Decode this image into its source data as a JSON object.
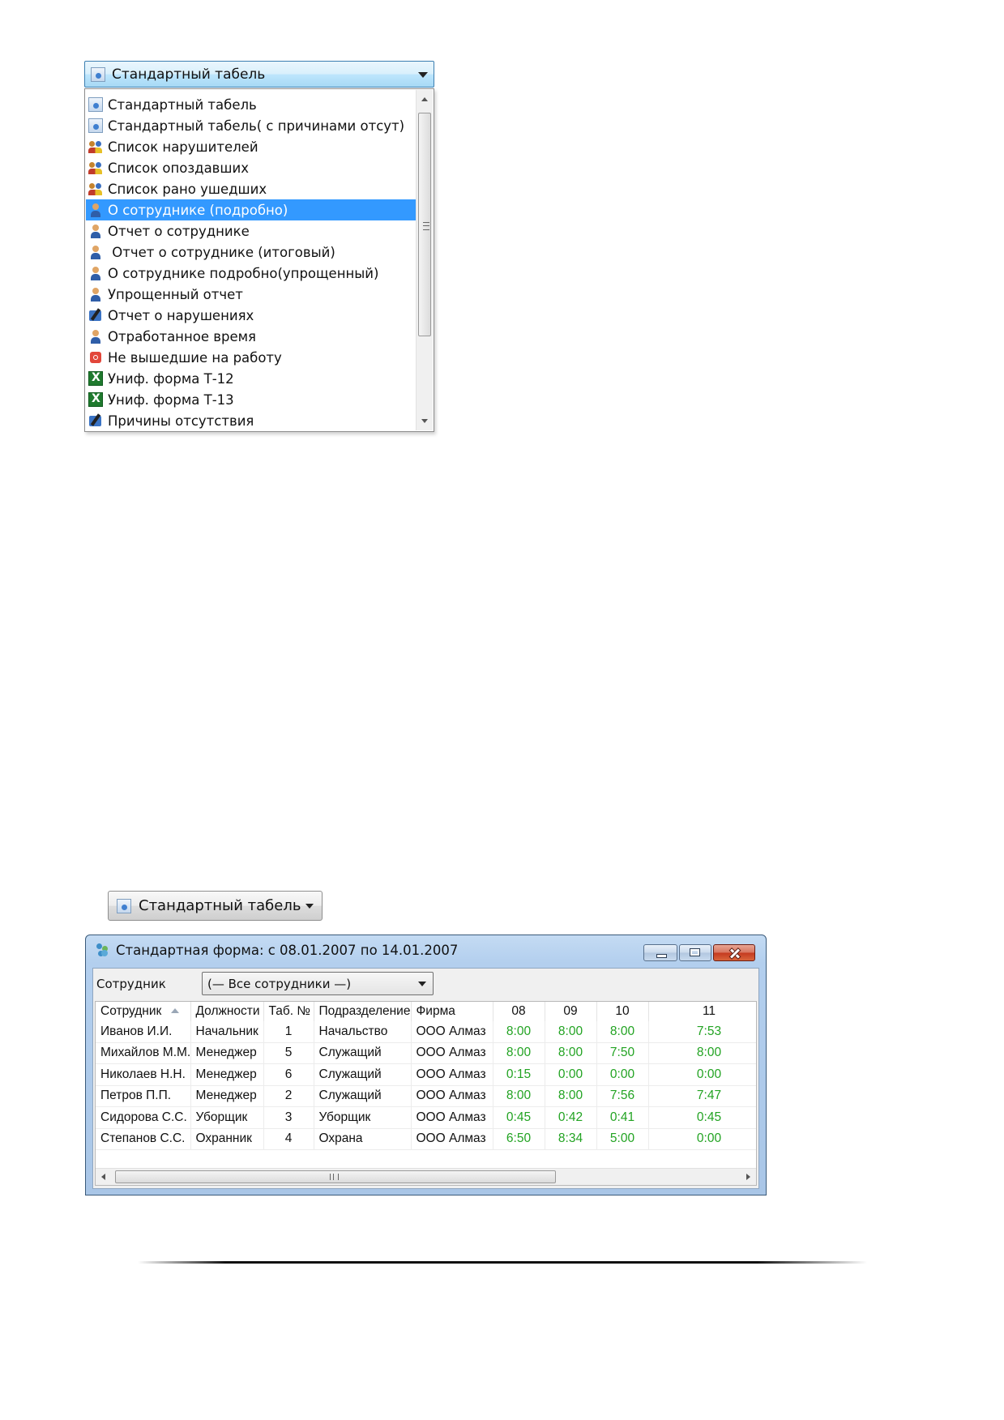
{
  "report_selector": {
    "selected": "Стандартный табель",
    "selected_icon": "report-doc-icon",
    "options": [
      {
        "label": "Стандартный табель",
        "icon": "report-doc-icon"
      },
      {
        "label": "Стандартный табель( с причинами отсут)",
        "icon": "report-doc-icon"
      },
      {
        "label": "Список нарушителей",
        "icon": "group-warning-icon"
      },
      {
        "label": "Список опоздавших",
        "icon": "group-warning-icon"
      },
      {
        "label": "Список рано ушедших",
        "icon": "group-warning-icon"
      },
      {
        "label": "О сотруднике (подробно)",
        "icon": "person-icon",
        "selected": true
      },
      {
        "label": "Отчет о сотруднике",
        "icon": "person-icon"
      },
      {
        "label": " Отчет о сотруднике (итоговый)",
        "icon": "person-icon"
      },
      {
        "label": "О сотруднике подробно(упрощенный)",
        "icon": "person-icon"
      },
      {
        "label": "Упрощенный отчет",
        "icon": "person-icon"
      },
      {
        "label": "Отчет о нарушениях",
        "icon": "edit-report-icon"
      },
      {
        "label": "Отработанное время",
        "icon": "person-icon"
      },
      {
        "label": "Не вышедшие на работу",
        "icon": "stop-icon"
      },
      {
        "label": "Униф. форма Т-12",
        "icon": "excel-icon"
      },
      {
        "label": "Униф. форма Т-13",
        "icon": "excel-icon"
      },
      {
        "label": "Причины отсутствия",
        "icon": "edit-report-icon"
      }
    ]
  },
  "report_button": {
    "label": "Стандартный табель",
    "icon": "report-doc-icon"
  },
  "window": {
    "title": "Стандартная форма: с 08.01.2007 по 14.01.2007",
    "icon": "app-icon",
    "filter_label": "Сотрудник",
    "filter_value": "(— Все сотрудники —)",
    "columns": [
      "Сотрудник",
      "Должности",
      "Таб. №",
      "Подразделение",
      "Фирма",
      "08",
      "09",
      "10",
      "11"
    ],
    "rows": [
      [
        "Иванов И.И.",
        "Начальник",
        "1",
        "Начальство",
        "ООО Алмаз",
        "8:00",
        "8:00",
        "8:00",
        "7:53"
      ],
      [
        "Михайлов М.М.",
        "Менеджер",
        "5",
        "Служащий",
        "ООО Алмаз",
        "8:00",
        "8:00",
        "7:50",
        "8:00"
      ],
      [
        "Николаев Н.Н.",
        "Менеджер",
        "6",
        "Служащий",
        "ООО Алмаз",
        "0:15",
        "0:00",
        "0:00",
        "0:00"
      ],
      [
        "Петров П.П.",
        "Менеджер",
        "2",
        "Служащий",
        "ООО Алмаз",
        "8:00",
        "8:00",
        "7:56",
        "7:47"
      ],
      [
        "Сидорова С.С.",
        "Уборщик",
        "3",
        "Уборщик",
        "ООО Алмаз",
        "0:45",
        "0:42",
        "0:41",
        "0:45"
      ],
      [
        "Степанов С.С.",
        "Охранник",
        "4",
        "Охрана",
        "ООО Алмаз",
        "6:50",
        "8:34",
        "5:00",
        "0:00"
      ]
    ],
    "hscroll_grip": "III"
  },
  "colors": {
    "selection": "#3399ff",
    "time_value": "#22a322",
    "combo_accent": "#3c7fb1"
  }
}
